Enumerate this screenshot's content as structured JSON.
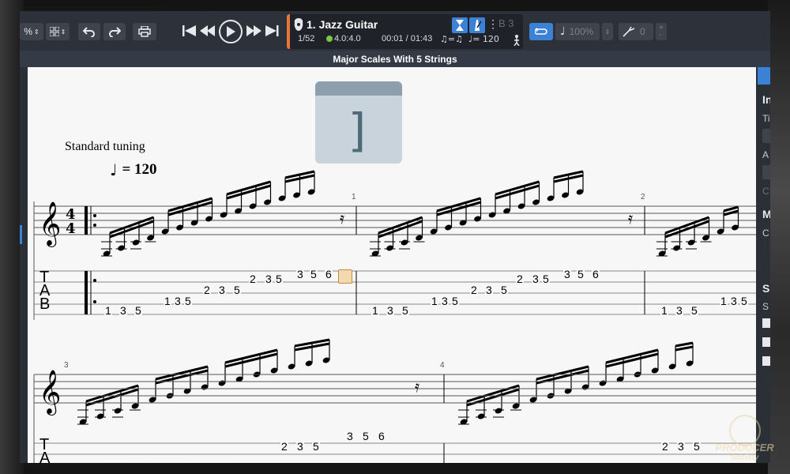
{
  "toolbar": {
    "zoom_value": "%",
    "track": {
      "name": "1. Jazz Guitar",
      "bar_position": "1/52",
      "signature": "4.0:4.0",
      "time": "00:01 / 01:43",
      "tempo_label": "= 120",
      "key": "B 3"
    },
    "speed_value": "100%",
    "pitch_value": "0",
    "colors": {
      "accent": "#3b82d6",
      "track_accent": "#e8743b"
    }
  },
  "score": {
    "title": "Major Scales With 5 Strings",
    "tuning": "Standard tuning",
    "tempo_value": "= 120",
    "measure_numbers": [
      "1",
      "2",
      "3",
      "4"
    ],
    "tab_clef": [
      "T",
      "A",
      "B"
    ],
    "system1": {
      "tab_numbers": [
        [
          "1",
          "3",
          "5"
        ],
        [
          "1",
          "3",
          "5"
        ],
        [
          "2",
          "3",
          "5"
        ],
        [
          "2",
          "3",
          "5"
        ],
        [
          "3",
          "5",
          "6"
        ]
      ]
    }
  },
  "right_panel": {
    "labels": [
      "In",
      "Ti",
      "A",
      "C",
      "M",
      "C",
      "S",
      "S"
    ]
  },
  "watermark": {
    "text": "PRODUCER",
    "sub": "Society"
  }
}
